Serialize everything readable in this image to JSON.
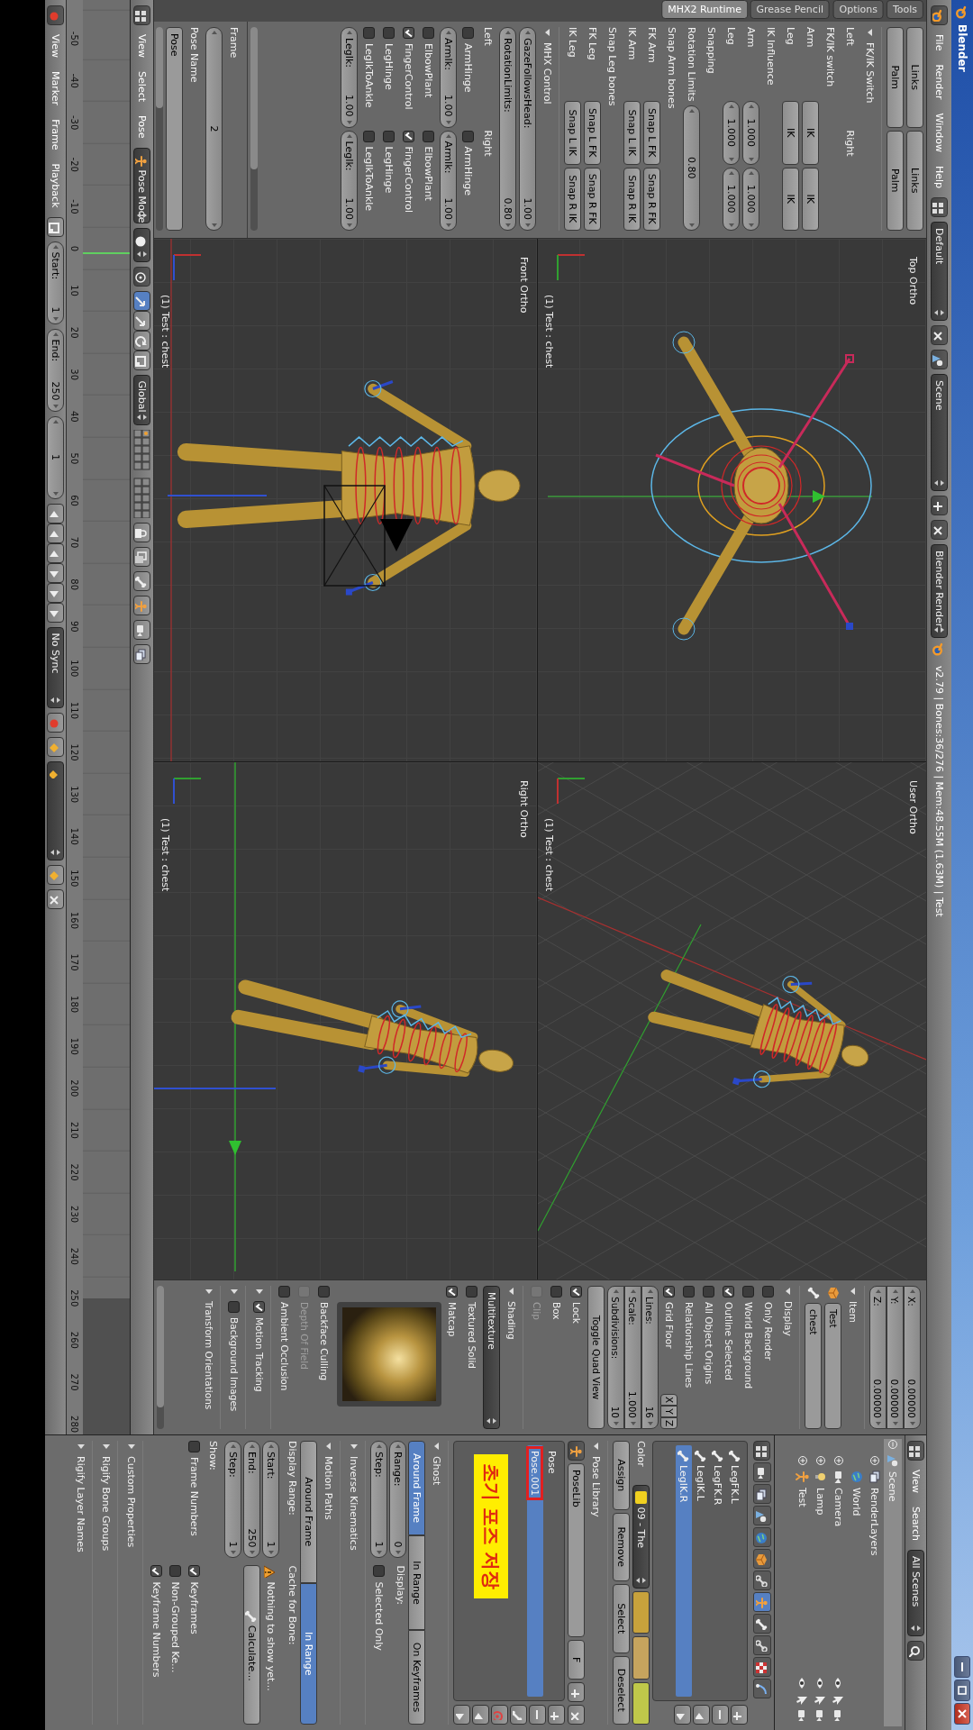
{
  "title_bar": {
    "title": "Blender"
  },
  "info_header": {
    "menus": [
      "File",
      "Render",
      "Window",
      "Help"
    ],
    "layout": "Default",
    "scene": "Scene",
    "engine": "Blender Render",
    "stats": "v2.79 | Bones:36/276 | Mem:48.55M (1.63M) | Test"
  },
  "tool_shelf": {
    "tabs": [
      {
        "label": "MHX2 Runtime",
        "selected": true
      },
      {
        "label": "Grease Pencil",
        "selected": false
      },
      {
        "label": "Options",
        "selected": false
      },
      {
        "label": "Tools",
        "selected": false
      }
    ],
    "rows": [
      {
        "kind": "cells",
        "cells": [
          {
            "kind": "button",
            "label": "Links"
          },
          {
            "kind": "button",
            "label": "Links"
          }
        ]
      },
      {
        "kind": "cells",
        "cells": [
          {
            "kind": "button",
            "label": "Palm"
          },
          {
            "kind": "button",
            "label": "Palm"
          }
        ]
      },
      {
        "kind": "header",
        "label": "FK/IK Switch",
        "expanded": true
      },
      {
        "kind": "cells",
        "cells": [
          {
            "kind": "text",
            "label": "Left"
          },
          {
            "kind": "text",
            "label": "Right"
          }
        ]
      },
      {
        "kind": "cells",
        "cells": [
          {
            "kind": "text",
            "label": "FK/IK switch"
          }
        ]
      },
      {
        "kind": "cells",
        "label": "Arm",
        "cells": [
          {
            "kind": "button",
            "label": "IK"
          },
          {
            "kind": "button",
            "label": "IK"
          }
        ]
      },
      {
        "kind": "cells",
        "label": "Leg",
        "cells": [
          {
            "kind": "button",
            "label": "IK"
          },
          {
            "kind": "button",
            "label": "IK"
          }
        ]
      },
      {
        "kind": "cells",
        "cells": [
          {
            "kind": "text",
            "label": "IK Influence"
          }
        ]
      },
      {
        "kind": "cells",
        "label": "Arm",
        "cells": [
          {
            "kind": "field",
            "value": "1.000"
          },
          {
            "kind": "field",
            "value": "1.000"
          }
        ]
      },
      {
        "kind": "cells",
        "label": "Leg",
        "cells": [
          {
            "kind": "field",
            "value": "1.000"
          },
          {
            "kind": "field",
            "value": "1.000"
          }
        ]
      },
      {
        "kind": "cells",
        "cells": [
          {
            "kind": "text",
            "label": "Snapping"
          }
        ]
      },
      {
        "kind": "cells",
        "label": "Rotation Limits",
        "cells": [
          {
            "kind": "field",
            "value": "0.80"
          }
        ]
      },
      {
        "kind": "cells",
        "cells": [
          {
            "kind": "text",
            "label": "Snap Arm bones"
          }
        ]
      },
      {
        "kind": "cells",
        "label": "FK Arm",
        "cells": [
          {
            "kind": "button",
            "label": "Snap L FK"
          },
          {
            "kind": "button",
            "label": "Snap R FK"
          }
        ]
      },
      {
        "kind": "cells",
        "label": "IK Arm",
        "cells": [
          {
            "kind": "button",
            "label": "Snap L IK"
          },
          {
            "kind": "button",
            "label": "Snap R IK"
          }
        ]
      },
      {
        "kind": "cells",
        "cells": [
          {
            "kind": "text",
            "label": "Snap Leg bones"
          }
        ]
      },
      {
        "kind": "cells",
        "label": "FK Leg",
        "cells": [
          {
            "kind": "button",
            "label": "Snap L FK"
          },
          {
            "kind": "button",
            "label": "Snap R FK"
          }
        ]
      },
      {
        "kind": "cells",
        "label": "IK Leg",
        "cells": [
          {
            "kind": "button",
            "label": "Snap L IK"
          },
          {
            "kind": "button",
            "label": "Snap R IK"
          }
        ]
      },
      {
        "kind": "header",
        "label": "MHX Control",
        "expanded": true
      },
      {
        "kind": "cells",
        "cells": [
          {
            "kind": "field",
            "label": "GazeFollowsHead:",
            "value": "1.00"
          }
        ]
      },
      {
        "kind": "cells",
        "cells": [
          {
            "kind": "field",
            "label": "RotationLimits:",
            "value": "0.80"
          }
        ]
      },
      {
        "kind": "cells",
        "cells": [
          {
            "kind": "text",
            "label": "Left"
          },
          {
            "kind": "text",
            "label": "Right"
          }
        ]
      },
      {
        "kind": "cells",
        "cells": [
          {
            "kind": "check",
            "label": "ArmHinge",
            "checked": false
          },
          {
            "kind": "check",
            "label": "ArmHinge",
            "checked": false
          }
        ]
      },
      {
        "kind": "cells",
        "cells": [
          {
            "kind": "field",
            "label": "ArmIk:",
            "value": "1.00"
          },
          {
            "kind": "field",
            "label": "ArmIk:",
            "value": "1.00"
          }
        ]
      },
      {
        "kind": "cells",
        "cells": [
          {
            "kind": "check",
            "label": "ElbowPlant",
            "checked": false
          },
          {
            "kind": "check",
            "label": "ElbowPlant",
            "checked": false
          }
        ]
      },
      {
        "kind": "cells",
        "cells": [
          {
            "kind": "check",
            "label": "FingerControl",
            "checked": true
          },
          {
            "kind": "check",
            "label": "FingerControl",
            "checked": true
          }
        ]
      },
      {
        "kind": "cells",
        "cells": [
          {
            "kind": "check",
            "label": "LegHinge",
            "checked": false
          },
          {
            "kind": "check",
            "label": "LegHinge",
            "checked": false
          }
        ]
      },
      {
        "kind": "cells",
        "cells": [
          {
            "kind": "check",
            "label": "LegIkToAnkle",
            "checked": false
          },
          {
            "kind": "check",
            "label": "LegIkToAnkle",
            "checked": false
          }
        ]
      },
      {
        "kind": "cells",
        "cells": [
          {
            "kind": "field",
            "label": "LegIk:",
            "value": "1.00"
          },
          {
            "kind": "field",
            "label": "LegIk:",
            "value": "1.00"
          }
        ]
      }
    ],
    "operator_rows": [
      {
        "kind": "cells",
        "cells": [
          {
            "kind": "text",
            "label": "Frame"
          }
        ]
      },
      {
        "kind": "cells",
        "cells": [
          {
            "kind": "field",
            "value": "2"
          }
        ]
      },
      {
        "kind": "cells",
        "cells": [
          {
            "kind": "text",
            "label": "Pose Name"
          }
        ]
      },
      {
        "kind": "cells",
        "cells": [
          {
            "kind": "textfield",
            "value": "Pose"
          }
        ]
      }
    ]
  },
  "viewports": [
    {
      "kind": "top",
      "name": "Top Ortho",
      "object": "(1) Test : chest"
    },
    {
      "kind": "user",
      "name": "User Ortho",
      "object": "(1) Test : chest"
    },
    {
      "kind": "front",
      "name": "Front Ortho",
      "object": "(1) Test : chest"
    },
    {
      "kind": "right",
      "name": "Right Ortho",
      "object": "(1) Test : chest"
    }
  ],
  "n_panel": {
    "rows": [
      {
        "kind": "column",
        "cells": [
          {
            "kind": "field",
            "label": "X:",
            "value": "0.00000"
          },
          {
            "kind": "field",
            "label": "Y:",
            "value": "0.00000"
          },
          {
            "kind": "field",
            "label": "Z:",
            "value": "0.00000"
          }
        ]
      },
      {
        "kind": "header",
        "label": "Item",
        "expanded": true
      },
      {
        "kind": "cells",
        "cells": [
          {
            "kind": "object_field",
            "value": "Test"
          }
        ]
      },
      {
        "kind": "cells",
        "cells": [
          {
            "kind": "bone_field",
            "value": "chest"
          }
        ]
      },
      {
        "kind": "header",
        "label": "Display",
        "expanded": true
      },
      {
        "kind": "cells",
        "cells": [
          {
            "kind": "check",
            "label": "Only Render",
            "checked": false
          }
        ]
      },
      {
        "kind": "cells",
        "cells": [
          {
            "kind": "check",
            "label": "World Background",
            "checked": false
          }
        ]
      },
      {
        "kind": "cells",
        "cells": [
          {
            "kind": "check",
            "label": "Outline Selected",
            "checked": true
          }
        ]
      },
      {
        "kind": "cells",
        "cells": [
          {
            "kind": "check",
            "label": "All Object Origins",
            "checked": false
          }
        ]
      },
      {
        "kind": "cells",
        "cells": [
          {
            "kind": "check",
            "label": "Relationship Lines",
            "checked": false
          }
        ]
      },
      {
        "kind": "cells",
        "cells": [
          {
            "kind": "check",
            "label": "Grid Floor",
            "checked": true
          },
          {
            "kind": "segment",
            "label": "X",
            "selected": false
          },
          {
            "kind": "segment",
            "label": "Y",
            "selected": false
          },
          {
            "kind": "segment",
            "label": "Z",
            "selected": false
          }
        ]
      },
      {
        "kind": "column",
        "cells": [
          {
            "kind": "field",
            "label": "Lines:",
            "value": "16"
          },
          {
            "kind": "field",
            "label": "Scale:",
            "value": "1.000"
          },
          {
            "kind": "field",
            "label": "Subdivisions:",
            "value": "10"
          }
        ]
      },
      {
        "kind": "cells",
        "cells": [
          {
            "kind": "button",
            "label": "Toggle Quad View"
          }
        ]
      },
      {
        "kind": "cells",
        "cells": [
          {
            "kind": "check",
            "label": "Lock",
            "checked": true
          }
        ]
      },
      {
        "kind": "cells",
        "cells": [
          {
            "kind": "check",
            "label": "Box",
            "checked": false
          }
        ]
      },
      {
        "kind": "cells",
        "cells": [
          {
            "kind": "check",
            "label": "Clip",
            "checked": false,
            "disabled": true
          }
        ]
      },
      {
        "kind": "header",
        "label": "Shading",
        "expanded": true
      },
      {
        "kind": "cells",
        "cells": [
          {
            "kind": "dropdown",
            "value": "Multitexture"
          }
        ]
      },
      {
        "kind": "cells",
        "cells": [
          {
            "kind": "check",
            "label": "Textured Solid",
            "checked": false
          }
        ]
      },
      {
        "kind": "cells",
        "cells": [
          {
            "kind": "check",
            "label": "Matcap",
            "checked": true
          }
        ]
      },
      {
        "kind": "matcap"
      },
      {
        "kind": "cells",
        "cells": [
          {
            "kind": "check",
            "label": "Backface Culling",
            "checked": false
          }
        ]
      },
      {
        "kind": "cells",
        "cells": [
          {
            "kind": "check",
            "label": "Depth Of Field",
            "checked": false,
            "disabled": true
          }
        ]
      },
      {
        "kind": "cells",
        "cells": [
          {
            "kind": "check",
            "label": "Ambient Occlusion",
            "checked": false
          }
        ]
      },
      {
        "kind": "header",
        "label": "Motion Tracking",
        "expanded": false,
        "checked": true
      },
      {
        "kind": "header",
        "label": "Background Images",
        "expanded": false,
        "checked": false
      },
      {
        "kind": "header",
        "label": "Transform Orientations",
        "expanded": false
      }
    ]
  },
  "view3d_header": {
    "menus": [
      "View",
      "Select",
      "Pose"
    ],
    "mode": "Pose Mode",
    "orientation": "Global"
  },
  "timeline": {
    "menus": [
      "View",
      "Marker",
      "Frame",
      "Playback"
    ],
    "fields": [
      {
        "label": "Start:",
        "value": "1"
      },
      {
        "label": "End:",
        "value": "250"
      },
      {
        "value": "1"
      }
    ],
    "sync": "No Sync",
    "ruler": [
      "-50",
      "-40",
      "-30",
      "-20",
      "-10",
      "0",
      "10",
      "20",
      "30",
      "40",
      "50",
      "60",
      "70",
      "80",
      "90",
      "100",
      "110",
      "120",
      "130",
      "140",
      "150",
      "160",
      "170",
      "180",
      "190",
      "200",
      "210",
      "220",
      "230",
      "240",
      "250",
      "260",
      "270",
      "280"
    ]
  },
  "outliner": {
    "menus": [
      "View",
      "Search"
    ],
    "filter": "All Scenes",
    "tree": [
      {
        "kind": "scene",
        "label": "Scene",
        "selected": true,
        "expanded": true,
        "children": [
          {
            "kind": "render_layers",
            "label": "RenderLayers",
            "selected": false,
            "expanded": false
          },
          {
            "kind": "world",
            "label": "World",
            "selected": false
          },
          {
            "kind": "camera",
            "label": "Camera",
            "selected": false,
            "expanded": false
          },
          {
            "kind": "lamp",
            "label": "Lamp",
            "selected": false,
            "expanded": false
          },
          {
            "kind": "armature",
            "label": "Test",
            "selected": false,
            "expanded": false
          }
        ]
      }
    ]
  },
  "properties": {
    "tabs": [
      {
        "kind": "render",
        "selected": false
      },
      {
        "kind": "render_layers",
        "selected": false
      },
      {
        "kind": "scene",
        "selected": false
      },
      {
        "kind": "world",
        "selected": false
      },
      {
        "kind": "object",
        "selected": false
      },
      {
        "kind": "constraints",
        "selected": false
      },
      {
        "kind": "armature",
        "selected": true
      },
      {
        "kind": "bone",
        "selected": false
      },
      {
        "kind": "bone_constraints",
        "selected": false
      },
      {
        "kind": "texture",
        "selected": false
      },
      {
        "kind": "physics",
        "selected": false
      }
    ],
    "rows": [
      {
        "kind": "list",
        "items": [
          {
            "label": "LegFK.L",
            "selected": false
          },
          {
            "label": "LegFK.R",
            "selected": false
          },
          {
            "label": "LegIK.L",
            "selected": false
          },
          {
            "label": "LegIK.R",
            "selected": true
          }
        ]
      },
      {
        "kind": "cells",
        "cells": [
          {
            "kind": "text",
            "label": "Color"
          },
          {
            "kind": "color_dropdown",
            "value": "09 - The"
          },
          {
            "kind": "swatch",
            "color": "#c8a23c"
          },
          {
            "kind": "swatch",
            "color": "#c6a45e"
          },
          {
            "kind": "swatch",
            "color": "#bfc84a"
          }
        ]
      },
      {
        "kind": "cells",
        "cells": [
          {
            "kind": "button",
            "label": "Assign"
          },
          {
            "kind": "button",
            "label": "Remove"
          },
          {
            "kind": "button",
            "label": "Select"
          },
          {
            "kind": "button",
            "label": "Deselect"
          }
        ]
      },
      {
        "kind": "header",
        "label": "Pose Library",
        "expanded": true
      },
      {
        "kind": "cells",
        "cells": [
          {
            "kind": "posefield",
            "value": "PoseLib"
          },
          {
            "kind": "button",
            "label": "F"
          },
          {
            "kind": "plus_button"
          },
          {
            "kind": "x_button"
          }
        ]
      },
      {
        "kind": "list",
        "items": [
          {
            "label": "Pose",
            "selected": false,
            "marked": false
          },
          {
            "label": "Pose.001",
            "selected": true,
            "marked": true
          }
        ],
        "annotation": "초기 포즈 저장"
      },
      {
        "kind": "header",
        "label": "Ghost",
        "expanded": true
      },
      {
        "kind": "cells",
        "cells": [
          {
            "kind": "segment",
            "label": "Around Frame",
            "selected": true
          },
          {
            "kind": "segment",
            "label": "In Range",
            "selected": false
          },
          {
            "kind": "segment",
            "label": "On Keyframes",
            "selected": false
          }
        ]
      },
      {
        "kind": "split",
        "left": [
          {
            "kind": "field",
            "label": "Range:",
            "value": "0"
          },
          {
            "kind": "field",
            "label": "Step:",
            "value": "1"
          }
        ],
        "right": [
          {
            "kind": "text",
            "label": "Display:"
          },
          {
            "kind": "check",
            "label": "Selected Only",
            "checked": false
          }
        ]
      },
      {
        "kind": "header",
        "label": "Inverse Kinematics",
        "expanded": false
      },
      {
        "kind": "header",
        "label": "Motion Paths",
        "expanded": true
      },
      {
        "kind": "cells",
        "cells": [
          {
            "kind": "segment",
            "label": "Around Frame",
            "selected": false
          },
          {
            "kind": "segment",
            "label": "In Range",
            "selected": true
          }
        ]
      },
      {
        "kind": "split",
        "left": [
          {
            "kind": "text",
            "label": "Display Range:"
          },
          {
            "kind": "field",
            "label": "Start:",
            "value": "1"
          },
          {
            "kind": "field",
            "label": "End:",
            "value": "250"
          },
          {
            "kind": "field",
            "label": "Step:",
            "value": "1"
          }
        ],
        "right": [
          {
            "kind": "text",
            "label": "Cache for Bone:"
          },
          {
            "kind": "warning",
            "label": "Nothing to show yet..."
          },
          {
            "kind": "bone_button",
            "label": "Calculate..."
          }
        ]
      },
      {
        "kind": "cells",
        "cells": [
          {
            "kind": "text",
            "label": "Show:"
          }
        ]
      },
      {
        "kind": "split",
        "left": [
          {
            "kind": "check",
            "label": "Frame Numbers",
            "checked": false
          }
        ],
        "right": [
          {
            "kind": "check",
            "label": "Keyframes",
            "checked": true
          },
          {
            "kind": "check",
            "label": "Non-Grouped Ke...",
            "checked": false
          },
          {
            "kind": "check",
            "label": "Keyframe Numbers",
            "checked": true
          }
        ]
      },
      {
        "kind": "header",
        "label": "Custom Properties",
        "expanded": false
      },
      {
        "kind": "header",
        "label": "Rigify Bone Groups",
        "expanded": false
      },
      {
        "kind": "header",
        "label": "Rigify Layer Names",
        "expanded": false
      }
    ]
  }
}
